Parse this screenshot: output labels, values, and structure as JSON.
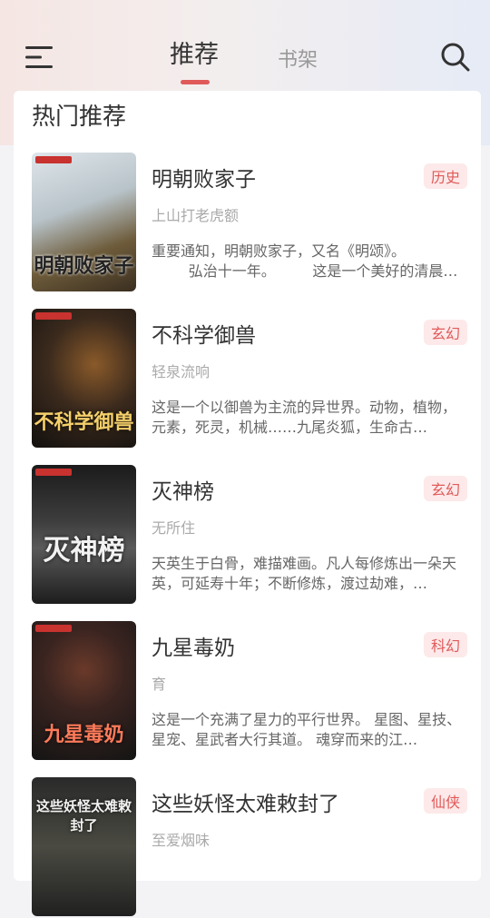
{
  "header": {
    "tabs": [
      {
        "label": "推荐",
        "active": true
      },
      {
        "label": "书架",
        "active": false
      }
    ],
    "icons": {
      "menu": "menu-icon",
      "search": "search-icon"
    },
    "accent_color": "#e05a5a"
  },
  "section": {
    "title": "热门推荐"
  },
  "books": [
    {
      "title": "明朝败家子",
      "tag": "历史",
      "author": "上山打老虎额",
      "desc": "重要通知，明朝败家子，又名《明颂》。\n        弘治十一年。        这是一个美好的清晨…",
      "cover_text": "明朝败家子"
    },
    {
      "title": "不科学御兽",
      "tag": "玄幻",
      "author": "轻泉流响",
      "desc": "这是一个以御兽为主流的异世界。动物，植物，元素，死灵，机械……九尾炎狐，生命古…",
      "cover_text": "不科学御兽"
    },
    {
      "title": "灭神榜",
      "tag": "玄幻",
      "author": "无所住",
      "desc": "天英生于白骨，难描难画。凡人每修炼出一朵天英，可延寿十年；不断修炼，渡过劫难，…",
      "cover_text": "灭神榜"
    },
    {
      "title": "九星毒奶",
      "tag": "科幻",
      "author": "育",
      "desc": "这是一个充满了星力的平行世界。 星图、星技、星宠、星武者大行其道。 魂穿而来的江…",
      "cover_text": "九星毒奶"
    },
    {
      "title": "这些妖怪太难敕封了",
      "tag": "仙侠",
      "author": "至爱烟味",
      "desc": "",
      "cover_text": "这些妖怪太难敕封了"
    }
  ]
}
